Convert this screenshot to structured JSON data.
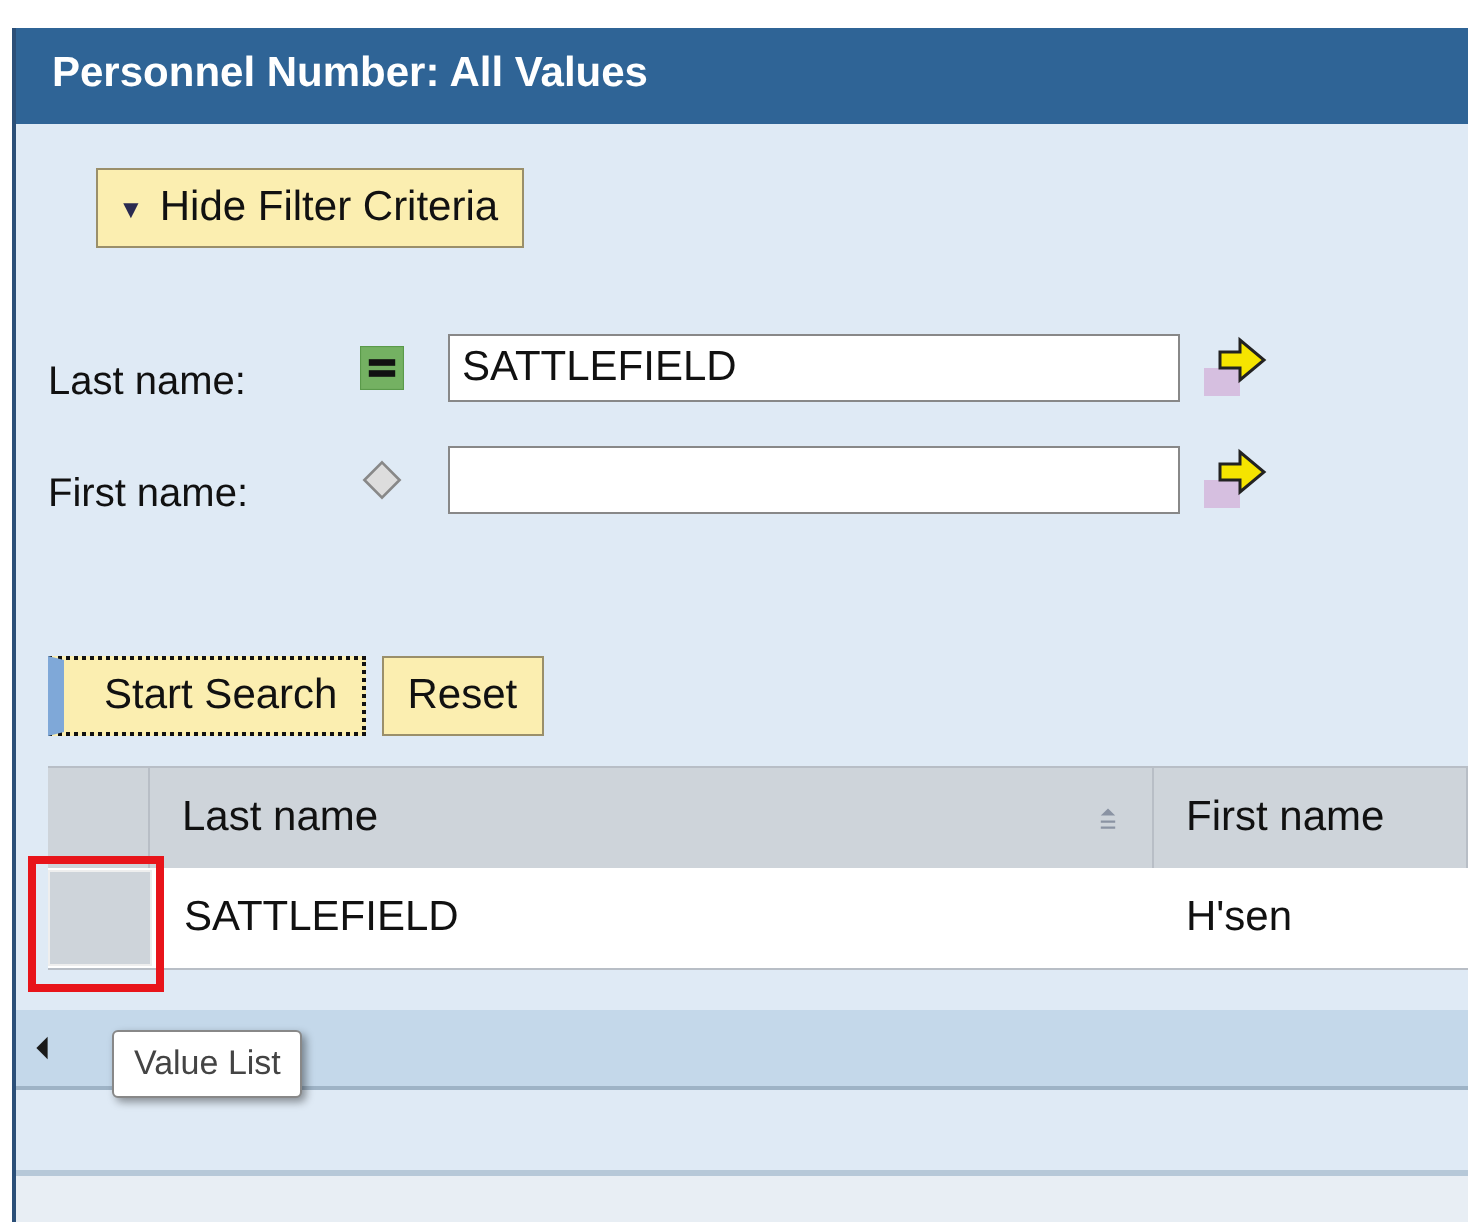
{
  "window": {
    "title": "Personnel Number: All Values"
  },
  "filter_toggle": {
    "icon": "▼",
    "label": "Hide Filter Criteria",
    "expanded": true
  },
  "filters": [
    {
      "label": "Last name:",
      "kind": "equals",
      "value": "SATTLEFIELD"
    },
    {
      "label": "First name:",
      "kind": "none"
    }
  ],
  "buttons": [
    {
      "label": "Start Search",
      "focused": true
    },
    {
      "label": "Reset",
      "focused": false
    }
  ],
  "table": {
    "columns": [
      {
        "label": "Last name",
        "sorted": true
      },
      {
        "label": "First name",
        "sorted": false
      }
    ],
    "rows": [
      {
        "cells": [
          "SATTLEFIELD",
          "H'sen"
        ],
        "highlighted": true
      }
    ]
  },
  "tooltip": {
    "text": "Value List"
  }
}
